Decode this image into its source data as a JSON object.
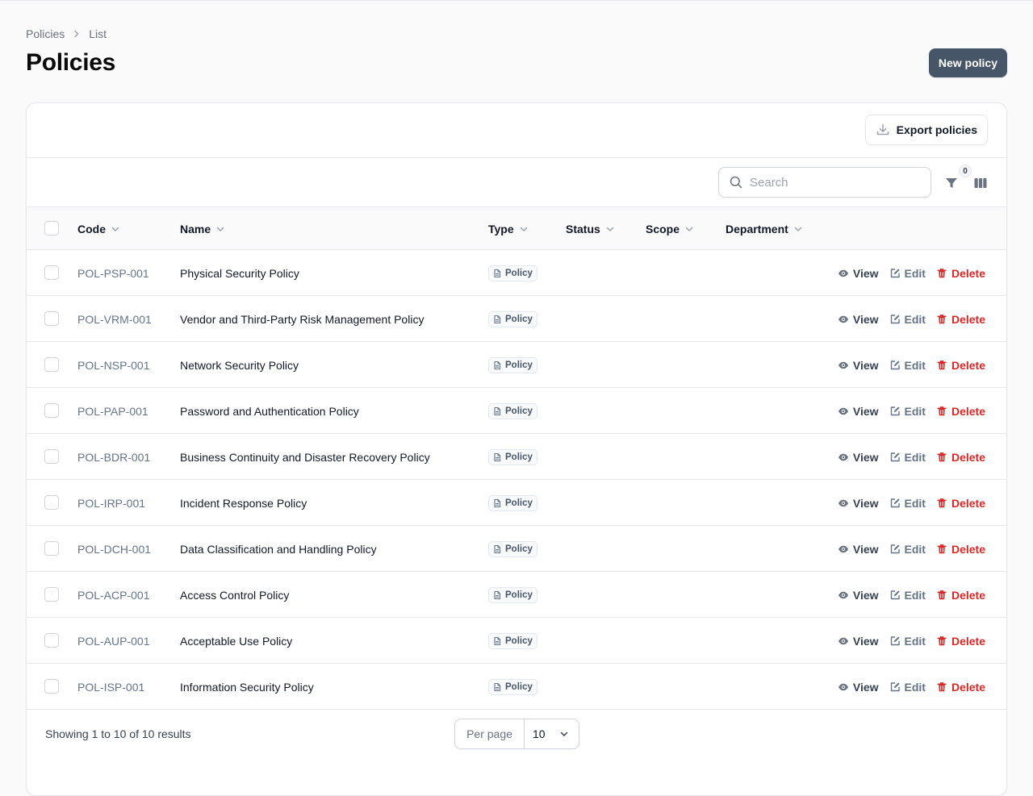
{
  "breadcrumb": {
    "root": "Policies",
    "current": "List"
  },
  "page": {
    "title": "Policies"
  },
  "actions": {
    "new_label": "New policy",
    "export_label": "Export policies"
  },
  "search": {
    "placeholder": "Search"
  },
  "filters": {
    "count": "0"
  },
  "columns": [
    "Code",
    "Name",
    "Type",
    "Status",
    "Scope",
    "Department"
  ],
  "rows": [
    {
      "code": "POL-PSP-001",
      "name": "Physical Security Policy",
      "type": "Policy"
    },
    {
      "code": "POL-VRM-001",
      "name": "Vendor and Third-Party Risk Management Policy",
      "type": "Policy"
    },
    {
      "code": "POL-NSP-001",
      "name": "Network Security Policy",
      "type": "Policy"
    },
    {
      "code": "POL-PAP-001",
      "name": "Password and Authentication Policy",
      "type": "Policy"
    },
    {
      "code": "POL-BDR-001",
      "name": "Business Continuity and Disaster Recovery Policy",
      "type": "Policy"
    },
    {
      "code": "POL-IRP-001",
      "name": "Incident Response Policy",
      "type": "Policy"
    },
    {
      "code": "POL-DCH-001",
      "name": "Data Classification and Handling Policy",
      "type": "Policy"
    },
    {
      "code": "POL-ACP-001",
      "name": "Access Control Policy",
      "type": "Policy"
    },
    {
      "code": "POL-AUP-001",
      "name": "Acceptable Use Policy",
      "type": "Policy"
    },
    {
      "code": "POL-ISP-001",
      "name": "Information Security Policy",
      "type": "Policy"
    }
  ],
  "row_actions": {
    "view": "View",
    "edit": "Edit",
    "delete": "Delete"
  },
  "footer": {
    "results": "Showing 1 to 10 of 10 results",
    "per_page_label": "Per page",
    "per_page_value": "10"
  },
  "colors": {
    "primary": "#475569",
    "danger": "#dc2626",
    "link": "#64748b"
  }
}
